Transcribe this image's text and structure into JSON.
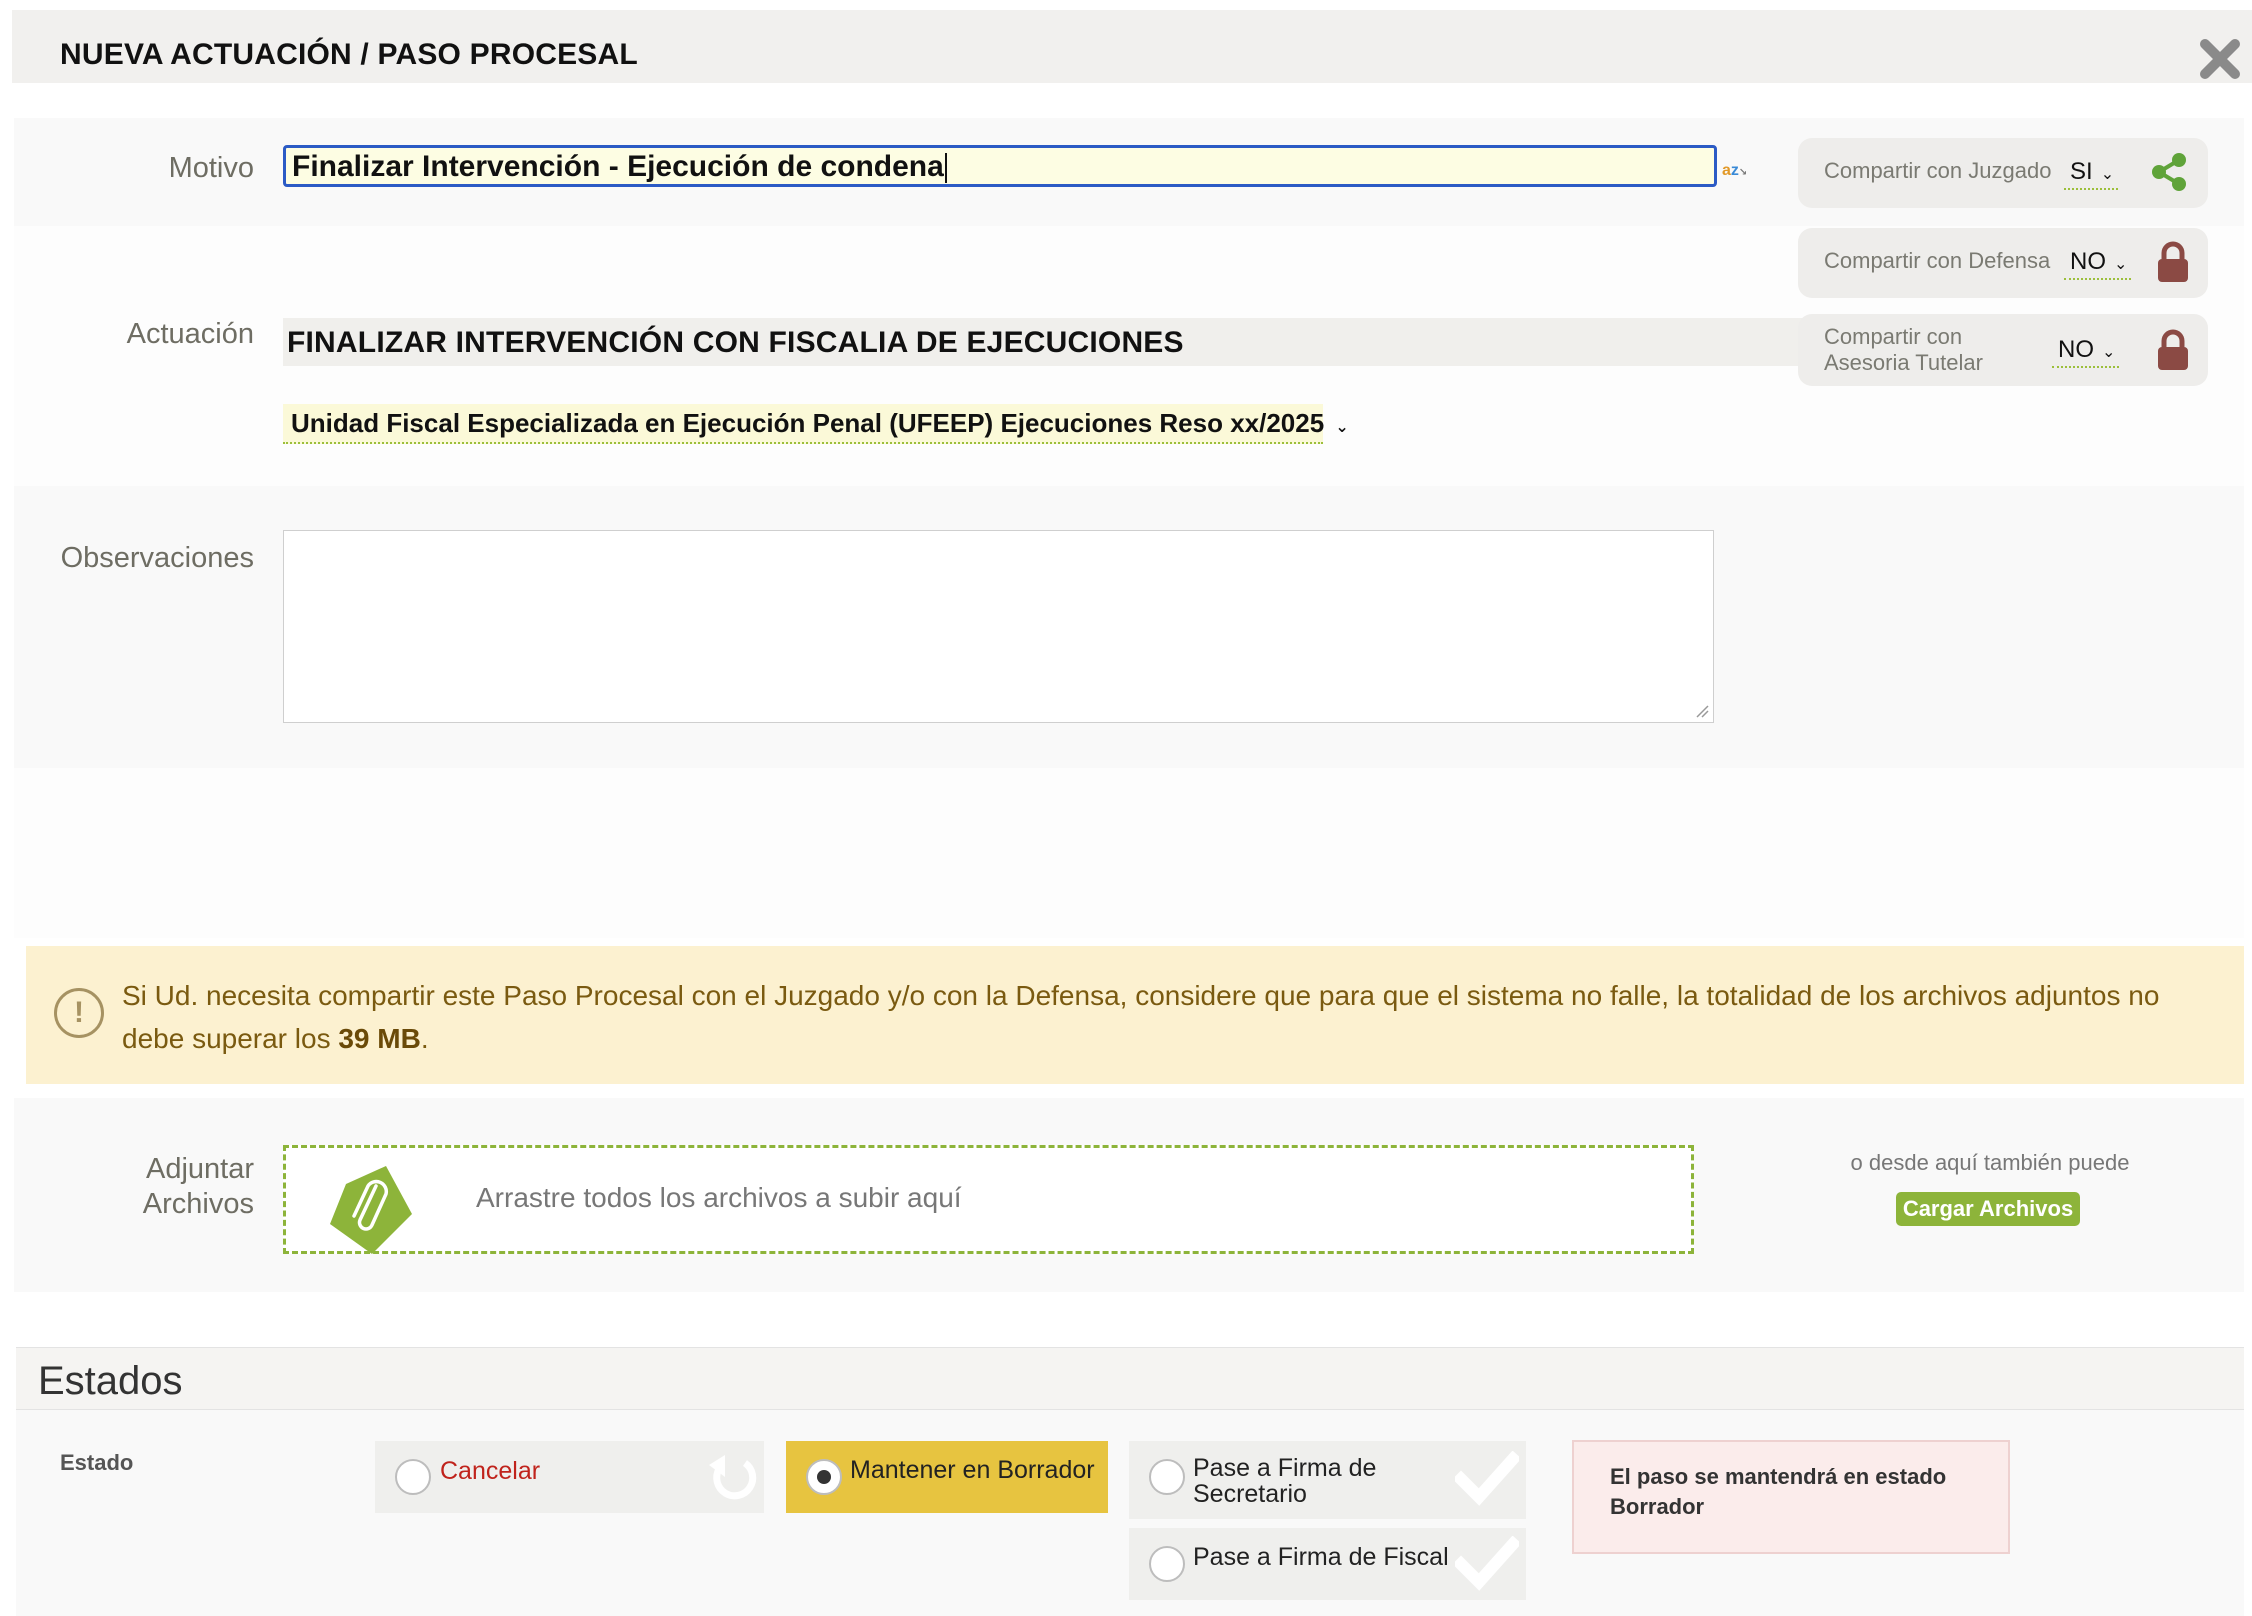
{
  "modal": {
    "title": "NUEVA ACTUACIÓN / PASO PROCESAL",
    "close_icon": "close-icon"
  },
  "motivo": {
    "label": "Motivo",
    "value": "Finalizar Intervención - Ejecución de condena",
    "spellcheck_icon": "az"
  },
  "sharing": [
    {
      "label": "Compartir con Juzgado",
      "value": "SI",
      "icon": "share-icon",
      "icon_color": "#5fa339"
    },
    {
      "label": "Compartir con Defensa",
      "value": "NO",
      "icon": "lock-icon",
      "icon_color": "#8b4a44"
    },
    {
      "label_line1": "Compartir con",
      "label_line2": "Asesoria Tutelar",
      "value": "NO",
      "icon": "lock-icon",
      "icon_color": "#8b4a44"
    }
  ],
  "actuacion": {
    "label": "Actuación",
    "value": "FINALIZAR INTERVENCIÓN CON FISCALIA DE EJECUCIONES",
    "unidad": "Unidad Fiscal Especializada en Ejecución Penal (UFEEP) Ejecuciones Reso xx/2025"
  },
  "observaciones": {
    "label": "Observaciones",
    "value": ""
  },
  "warning": {
    "text_before": "Si Ud. necesita compartir este Paso Procesal con el Juzgado y/o con la Defensa, considere que para que el sistema no falle, la totalidad de los archivos adjuntos no debe superar los ",
    "limit": "39 MB",
    "text_after": ".",
    "icon": "!"
  },
  "attachments": {
    "label_line1": "Adjuntar",
    "label_line2": "Archivos",
    "drop_text": "Arrastre todos los archivos a subir aquí",
    "alt_text": "o desde aquí también puede",
    "upload_button": "Cargar Archivos"
  },
  "estados": {
    "section_title": "Estados",
    "field_label": "Estado",
    "options": [
      {
        "label": "Cancelar",
        "selected": false,
        "color": "#c0231c"
      },
      {
        "label": "Mantener en Borrador",
        "selected": true,
        "color": "#e7c440"
      },
      {
        "label_line1": "Pase a Firma de",
        "label_line2": "Secretario",
        "selected": false
      },
      {
        "label": "Pase a Firma de Fiscal",
        "selected": false
      }
    ],
    "info_line1": "El paso se mantendrá en estado",
    "info_line2": "Borrador"
  },
  "colors": {
    "accent_green": "#8db43a",
    "focus_blue": "#2c5bc5",
    "warning_bg": "#fcf1d0",
    "selected_state": "#e7c440"
  }
}
